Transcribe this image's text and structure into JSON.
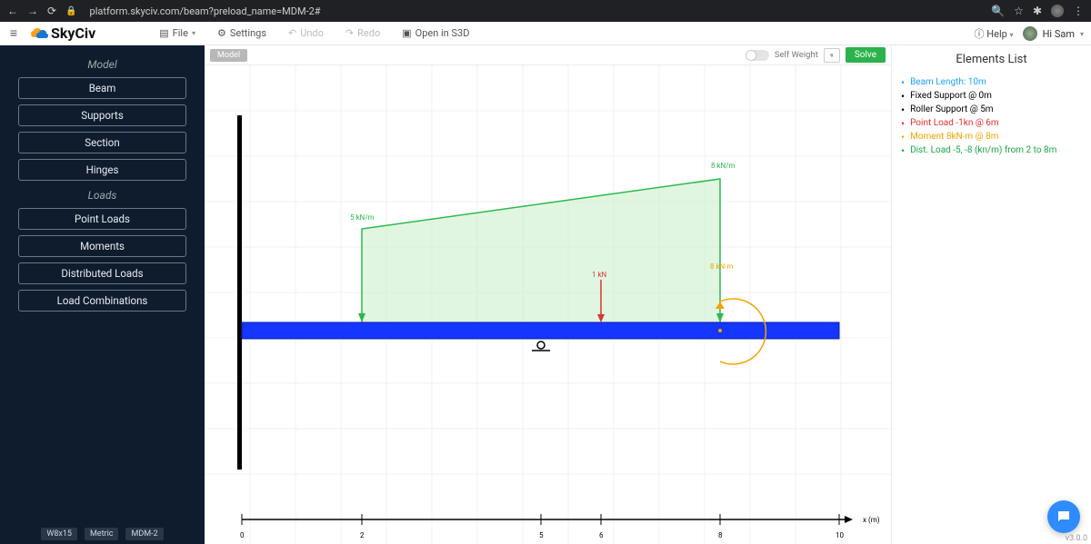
{
  "browser": {
    "url": "platform.skyciv.com/beam?preload_name=MDM-2#"
  },
  "appbar": {
    "logo_text": "SkyCiv",
    "file_label": "File",
    "settings_label": "Settings",
    "undo_label": "Undo",
    "redo_label": "Redo",
    "open_s3d_label": "Open in S3D",
    "help_label": "Help",
    "user_greeting": "Hi Sam"
  },
  "sidebar": {
    "section_model": "Model",
    "model_items": [
      "Beam",
      "Supports",
      "Section",
      "Hinges"
    ],
    "section_loads": "Loads",
    "loads_items": [
      "Point Loads",
      "Moments",
      "Distributed Loads",
      "Load Combinations"
    ],
    "tags": [
      "W8x15",
      "Metric",
      "MDM-2"
    ]
  },
  "canvas_header": {
    "tab_model": "Model",
    "self_weight_label": "Self Weight",
    "solve_label": "Solve"
  },
  "plot_labels": {
    "dl_start": "5 kN/m",
    "dl_end": "8 kN/m",
    "point_load": "1 kN",
    "moment": "8 kN·m",
    "x_axis": "x (m)",
    "ticks": [
      "0",
      "2",
      "5",
      "6",
      "8",
      "10"
    ]
  },
  "right_pane": {
    "title": "Elements List",
    "items": [
      {
        "bullet_color": "#1ea2ff",
        "text": "Beam Length: 10m",
        "text_color": "#1ea2ff"
      },
      {
        "bullet_color": "#000000",
        "text": "Fixed Support @ 0m",
        "text_color": "#000000"
      },
      {
        "bullet_color": "#000000",
        "text": "Roller Support @ 5m",
        "text_color": "#000000"
      },
      {
        "bullet_color": "#e2302f",
        "text": "Point Load -1kn @ 6m",
        "text_color": "#e2302f"
      },
      {
        "bullet_color": "#f4a300",
        "text": "Moment 8kN-m @ 8m",
        "text_color": "#f4a300"
      },
      {
        "bullet_color": "#18a64a",
        "text": "Dist. Load -5, -8 (kn/m) from 2 to 8m",
        "text_color": "#18a64a"
      }
    ]
  },
  "footer": {
    "version": "v3.0.0"
  },
  "chart_data": {
    "type": "diagram",
    "beam_length_m": 10,
    "supports": [
      {
        "type": "fixed",
        "x_m": 0
      },
      {
        "type": "roller",
        "x_m": 5
      }
    ],
    "point_loads": [
      {
        "x_m": 6,
        "F_kN": -1
      }
    ],
    "moments": [
      {
        "x_m": 8,
        "M_kNm": 8
      }
    ],
    "distributed_loads": [
      {
        "x_start_m": 2,
        "x_end_m": 8,
        "w_start_kNm": -5,
        "w_end_kNm": -8
      }
    ],
    "x_axis_label": "x (m)",
    "x_ticks": [
      0,
      2,
      5,
      6,
      8,
      10
    ]
  }
}
